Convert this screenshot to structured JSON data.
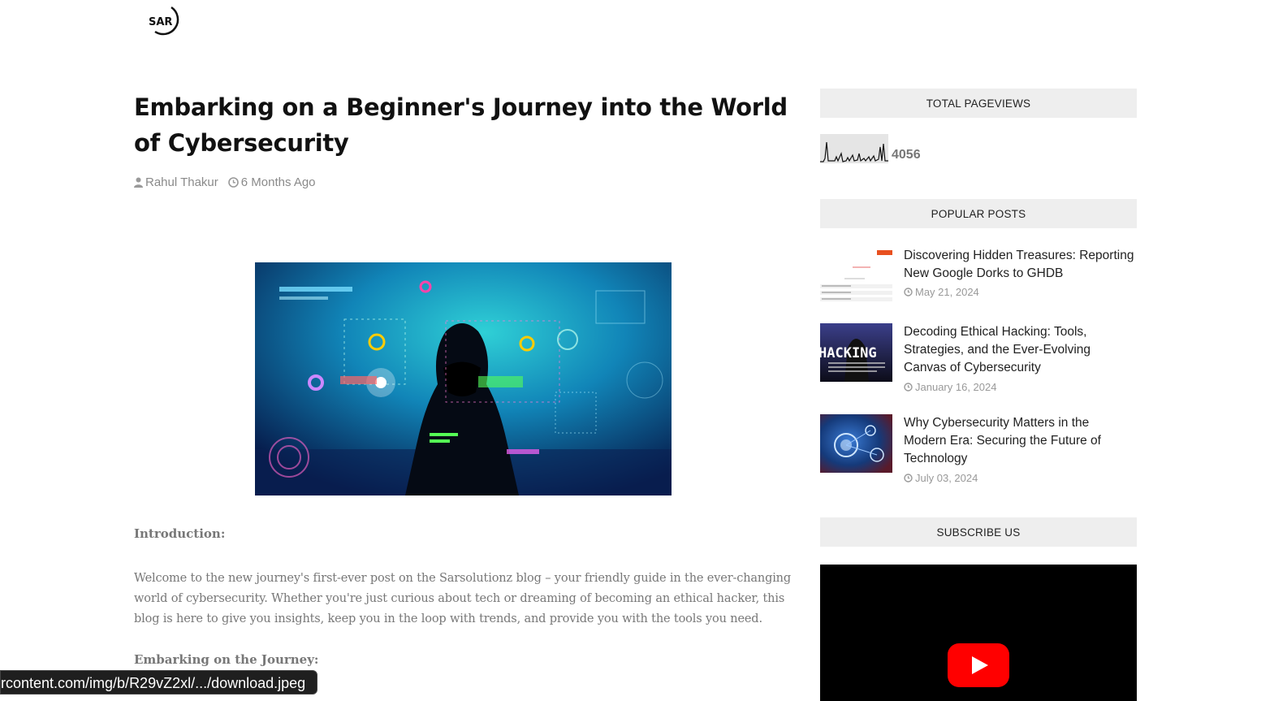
{
  "logo": {
    "text": "SAR"
  },
  "article": {
    "title": "Embarking on a Beginner's Journey into the World of Cybersecurity",
    "author": "Rahul Thakur",
    "time_ago": "6 Months Ago",
    "intro_heading": "Introduction:",
    "intro_paragraph": "Welcome to the new journey's first-ever post on the Sarsolutionz blog – your friendly guide in the ever-changing world of cybersecurity. Whether you're just curious about tech or dreaming of becoming an ethical hacker, this blog is here to give you insights, keep you in the loop with trends, and provide you with the tools you need.",
    "journey_heading": "Embarking on the Journey:"
  },
  "sidebar": {
    "pageviews": {
      "header": "TOTAL PAGEVIEWS",
      "count": "4056"
    },
    "popular": {
      "header": "POPULAR POSTS",
      "posts": [
        {
          "title": "Discovering Hidden Treasures: Reporting New Google Dorks to GHDB",
          "date": "May 21, 2024"
        },
        {
          "title": "Decoding Ethical Hacking: Tools, Strategies, and the Ever-Evolving Canvas of Cybersecurity",
          "date": "January 16, 2024",
          "thumb_text": "HACKING"
        },
        {
          "title": "Why Cybersecurity Matters in the Modern Era: Securing the Future of Technology",
          "date": "July 03, 2024"
        }
      ]
    },
    "subscribe": {
      "header": "SUBSCRIBE US"
    }
  },
  "status_url": "rcontent.com/img/b/R29vZ2xl/.../download.jpeg",
  "colors": {
    "accent_youtube": "#ff0000",
    "widget_bg": "#eeeeee",
    "muted_text": "#777777"
  }
}
